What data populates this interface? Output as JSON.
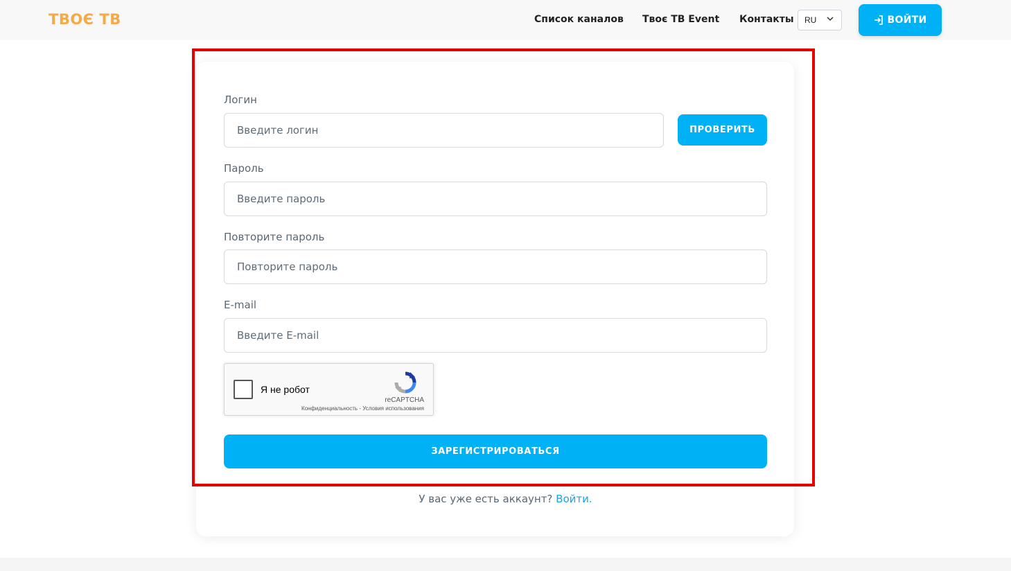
{
  "header": {
    "logo": "ТВОЄ ТВ",
    "nav": {
      "channels": "Список каналов",
      "event": "Твоє ТВ Event",
      "contacts": "Контакты"
    },
    "language": "RU",
    "login_label": "ВОЙТИ"
  },
  "form": {
    "login": {
      "label": "Логин",
      "placeholder": "Введите логин",
      "check_label": "ПРОВЕРИТЬ"
    },
    "password": {
      "label": "Пароль",
      "placeholder": "Введите пароль"
    },
    "password_repeat": {
      "label": "Повторите пароль",
      "placeholder": "Повторите пароль"
    },
    "email": {
      "label": "E-mail",
      "placeholder": "Введите E-mail"
    },
    "recaptcha": {
      "label": "Я не робот",
      "brand": "reCAPTCHA",
      "privacy": "Конфиденциальность",
      "separator": " - ",
      "terms": "Условия использования"
    },
    "register_label": "ЗАРЕГИСТРИРОВАТЬСЯ"
  },
  "footer": {
    "question": "У вас уже есть аккаунт? ",
    "login_link": "Войти."
  },
  "colors": {
    "accent": "#00b2f5",
    "logo": "#f5a947",
    "highlight": "#e60000",
    "link": "#1aa3e8"
  }
}
